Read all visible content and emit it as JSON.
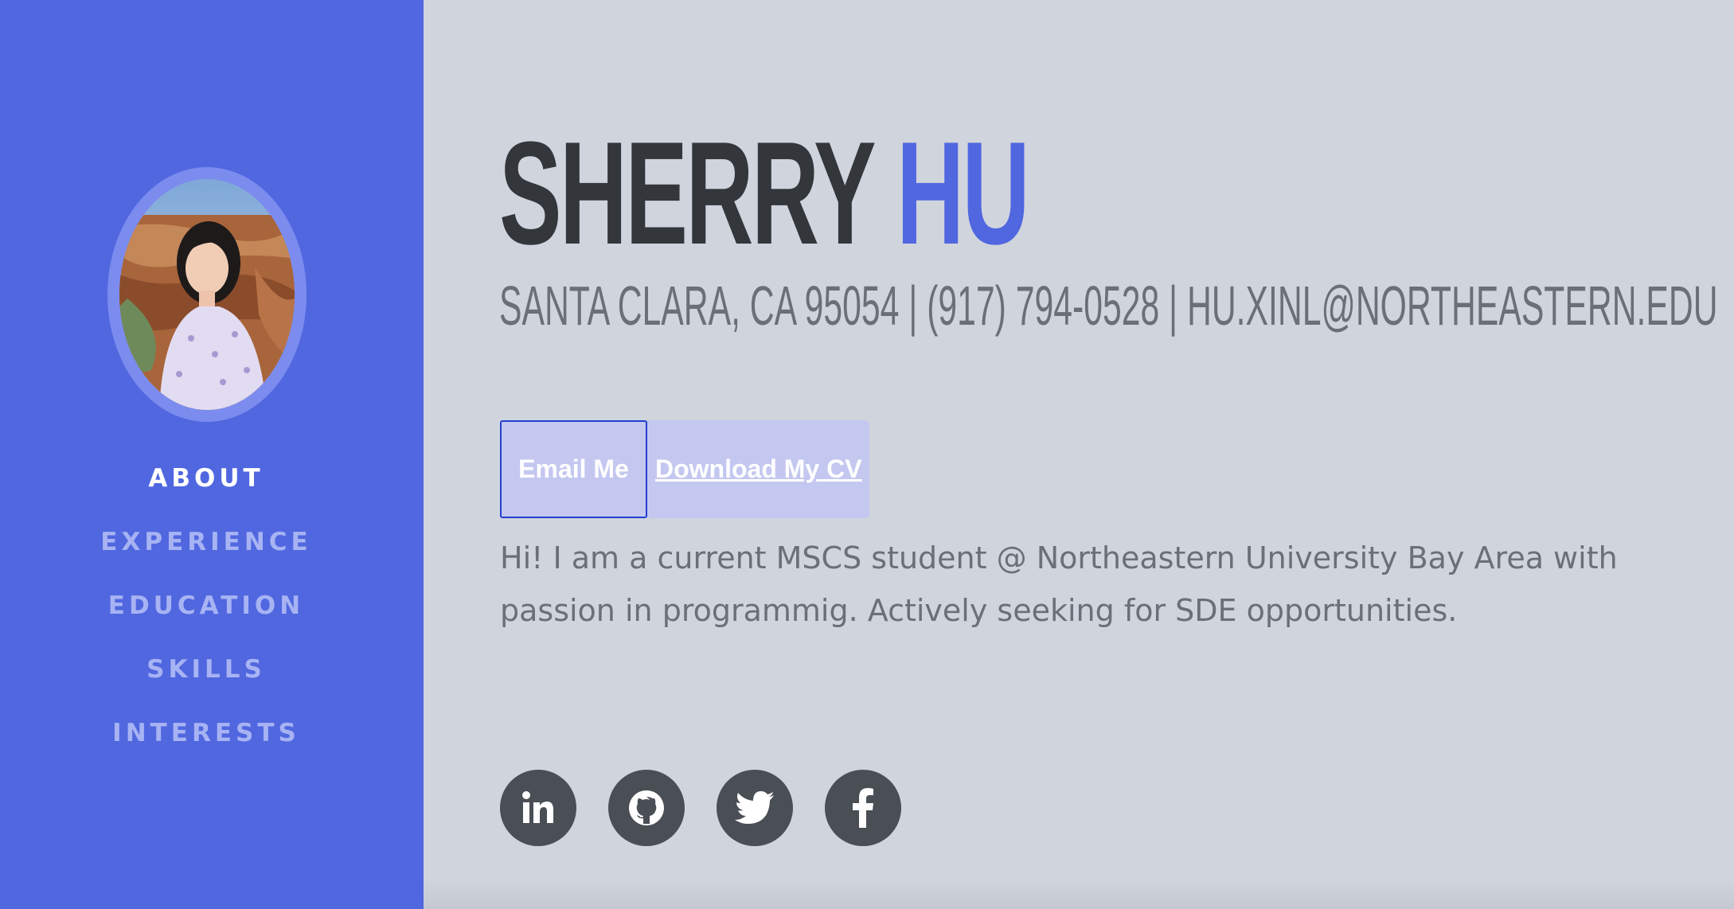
{
  "profile": {
    "first_name": "SHERRY",
    "last_name": "HU",
    "contact": "SANTA CLARA, CA 95054 | (917) 794-0528 | HU.XINL@NORTHEASTERN.EDU",
    "intro": "Hi! I am a current MSCS student @ Northeastern University Bay Area with passion in programmig. Actively seeking for SDE opportunities."
  },
  "nav": {
    "items": [
      {
        "label": "ABOUT",
        "active": true
      },
      {
        "label": "EXPERIENCE",
        "active": false
      },
      {
        "label": "EDUCATION",
        "active": false
      },
      {
        "label": "SKILLS",
        "active": false
      },
      {
        "label": "INTERESTS",
        "active": false
      }
    ]
  },
  "buttons": {
    "email_label": "Email Me",
    "cv_label": "Download My CV"
  },
  "social": [
    {
      "icon": "linkedin-icon"
    },
    {
      "icon": "github-icon"
    },
    {
      "icon": "twitter-icon"
    },
    {
      "icon": "facebook-icon"
    }
  ],
  "colors": {
    "sidebar": "#5067e0",
    "accent": "#5067e0",
    "background": "#d0d4dd",
    "heading": "#33373c",
    "text": "#6b6f77",
    "nav_inactive": "#a7b3f3",
    "social_bg": "#4a4e55"
  }
}
